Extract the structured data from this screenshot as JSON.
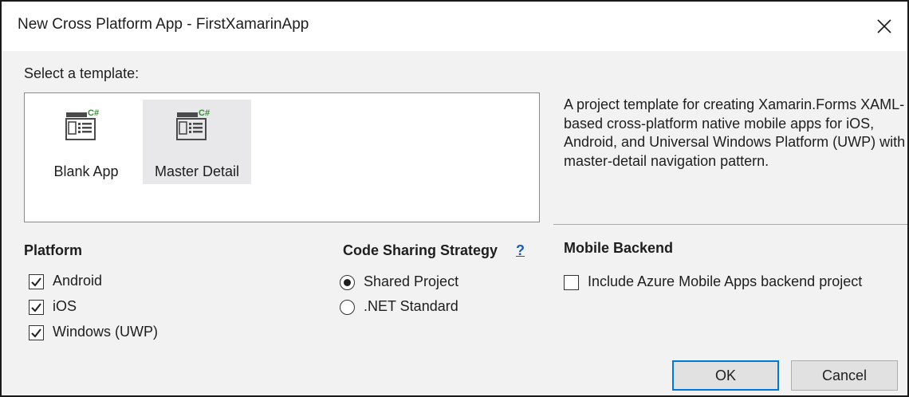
{
  "window": {
    "title": "New Cross Platform App - FirstXamarinApp"
  },
  "templates": {
    "heading": "Select a template:",
    "items": [
      {
        "label": "Blank App",
        "icon": "csharp-mobile-template-icon",
        "selected": false
      },
      {
        "label": "Master Detail",
        "icon": "csharp-mobile-template-icon",
        "selected": true
      }
    ],
    "description": "A project template for creating Xamarin.Forms XAML-based cross-platform native mobile apps for iOS, Android, and Universal Windows Platform (UWP) with master-detail navigation pattern."
  },
  "platform": {
    "heading": "Platform",
    "options": [
      {
        "label": "Android",
        "checked": true
      },
      {
        "label": "iOS",
        "checked": true
      },
      {
        "label": "Windows (UWP)",
        "checked": true
      }
    ]
  },
  "code_sharing": {
    "heading": "Code Sharing Strategy",
    "help": "?",
    "options": [
      {
        "label": "Shared Project",
        "selected": true
      },
      {
        "label": ".NET Standard",
        "selected": false
      }
    ]
  },
  "backend": {
    "heading": "Mobile Backend",
    "option": {
      "label": "Include Azure Mobile Apps backend project",
      "checked": false
    }
  },
  "buttons": {
    "ok": "OK",
    "cancel": "Cancel"
  },
  "colors": {
    "accent": "#0078d7",
    "link": "#1a5cb8",
    "selected_item_bg": "#e8e8ea"
  }
}
